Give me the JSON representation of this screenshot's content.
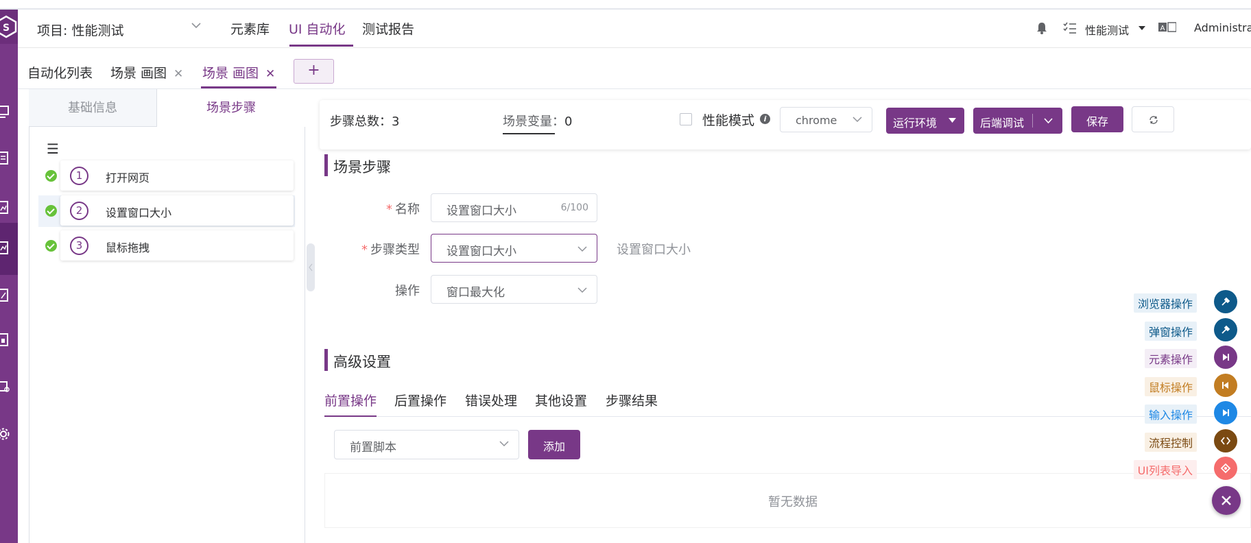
{
  "header": {
    "project_label": "项目: 性能测试",
    "nav": [
      "元素库",
      "UI 自动化",
      "测试报告"
    ],
    "workspace": "性能测试",
    "user": "Administrat"
  },
  "tabs": {
    "items": [
      {
        "label": "自动化列表",
        "closable": false
      },
      {
        "label": "场景 画图",
        "closable": true
      },
      {
        "label": "场景 画图",
        "closable": true
      }
    ],
    "close_glyph": "✕",
    "add_glyph": "+"
  },
  "left_panel": {
    "tabs": [
      "基础信息",
      "场景步骤"
    ],
    "steps": [
      {
        "num": "1",
        "label": "打开网页"
      },
      {
        "num": "2",
        "label": "设置窗口大小"
      },
      {
        "num": "3",
        "label": "鼠标拖拽"
      }
    ]
  },
  "toolbar": {
    "step_total_label": "步骤总数",
    "step_total": "3",
    "scene_var_label": "场景变量",
    "scene_var": "0",
    "perf_mode_label": "性能模式",
    "browser": "chrome",
    "run_env_label": "运行环境",
    "backend_debug_label": "后端调试",
    "save_label": "保存"
  },
  "form": {
    "section_title": "场景步骤",
    "name_label": "名称",
    "name_value": "设置窗口大小",
    "name_counter": "6/100",
    "type_label": "步骤类型",
    "type_value": "设置窗口大小",
    "type_hint": "设置窗口大小",
    "op_label": "操作",
    "op_value": "窗口最大化"
  },
  "advanced": {
    "section_title": "高级设置",
    "tabs": [
      "前置操作",
      "后置操作",
      "错误处理",
      "其他设置",
      "步骤结果"
    ],
    "script_select": "前置脚本",
    "add_label": "添加",
    "empty_text": "暂无数据"
  },
  "float_menu": [
    {
      "label": "浏览器操作",
      "color": "#0e5a8a"
    },
    {
      "label": "弹窗操作",
      "color": "#0e5a8a"
    },
    {
      "label": "元素操作",
      "color": "#783887"
    },
    {
      "label": "鼠标操作",
      "color": "#c27d22"
    },
    {
      "label": "输入操作",
      "color": "#1e88e5"
    },
    {
      "label": "流程控制",
      "color": "#7b4a12"
    },
    {
      "label": "UI列表导入",
      "color": "#f56c6c"
    }
  ],
  "colors": {
    "accent": "#783887"
  }
}
